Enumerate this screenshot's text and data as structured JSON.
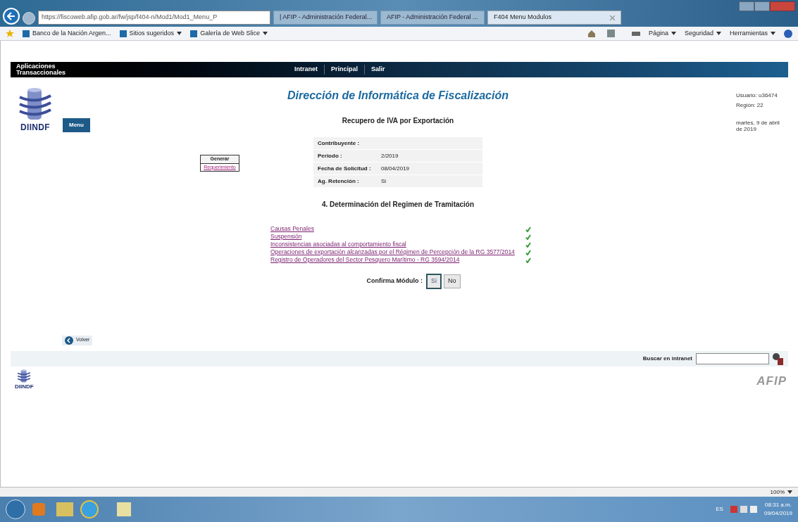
{
  "browser": {
    "address": "https://fiscoweb.afip.gob.ar/fw/jsp/f404-n/Mod1/Mod1_Menu_P",
    "tabs": [
      {
        "label": "| AFIP - Administración Federal...",
        "selected": false
      },
      {
        "label": "AFIP - Administración Federal ...",
        "selected": false
      },
      {
        "label": "F404 Menu Modulos",
        "selected": true
      }
    ],
    "favorites": [
      "Banco de la Nación Argen...",
      "Sitios sugeridos",
      "Galería de Web Slice"
    ],
    "commands": [
      "Página",
      "Seguridad",
      "Herramientas"
    ]
  },
  "app_bar": {
    "title": "Aplicaciones Transaccionales",
    "links": [
      "Intranet",
      "Principal",
      "Salir"
    ]
  },
  "header": {
    "logo": "DIINDF",
    "menu_button": "Menu",
    "title": "Dirección de Informática de Fiscalización",
    "subtitle": "Recupero de IVA por Exportación",
    "user": "Usuario: u36474",
    "region": "Región: 22",
    "date": "martes, 9 de abril de 2019"
  },
  "generate": {
    "title": "Generar",
    "link": "Requerimiento"
  },
  "info": [
    {
      "label": "Contribuyente :"
    },
    {
      "label": "Periodo :",
      "value": "2/2019"
    },
    {
      "label": "Fecha de Solicitud :",
      "value": "08/04/2019"
    },
    {
      "label": "Ag. Retención :",
      "value": "Si"
    }
  ],
  "section_title": "4. Determinación del Regimen de Tramitación",
  "modules": [
    {
      "label": "Causas Penales",
      "checked": true
    },
    {
      "label": "Suspensión",
      "checked": true
    },
    {
      "label": "Inconsistencias asociadas al comportamiento fiscal",
      "checked": true
    },
    {
      "label": "Operaciones de exportación alcanzadas por el Régimen de Percepción de la RG 3577/2014",
      "checked": true
    },
    {
      "label": "Registro de Operadores del Sector Pesquero Marítimo - RG 3594/2014",
      "checked": true
    }
  ],
  "confirm": {
    "label": "Confirma Módulo :",
    "options": [
      {
        "label": "Si",
        "selected": true
      },
      {
        "label": "No",
        "selected": false
      }
    ]
  },
  "back_button": "Volver",
  "search": {
    "label": "Buscar en intranet"
  },
  "footer": {
    "logo_left": "DIINDF",
    "logo_right": "AFIP"
  },
  "status_bar": {
    "zoom": "100%"
  },
  "taskbar": {
    "language": "ES",
    "time": "08:31 a.m.",
    "date": "09/04/2019"
  }
}
